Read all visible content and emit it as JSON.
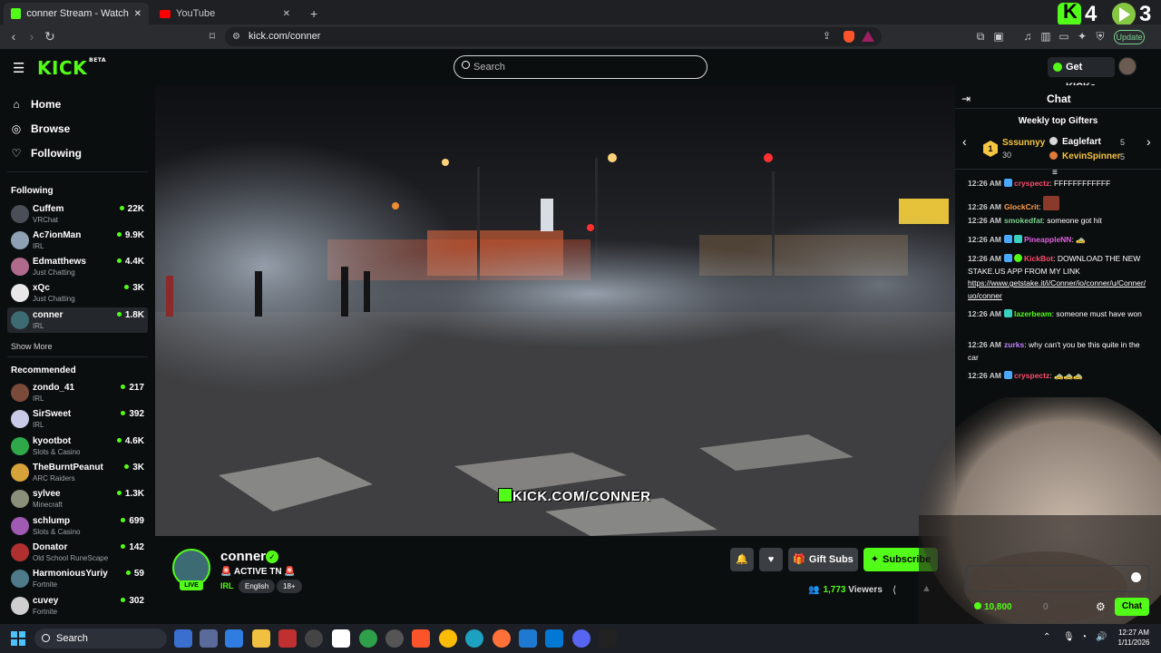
{
  "browser": {
    "tabs": [
      {
        "title": "conner Stream - Watch Live o",
        "active": true
      },
      {
        "title": "YouTube",
        "active": false
      }
    ],
    "url": "kick.com/conner",
    "update_label": "Update"
  },
  "overlay": {
    "counter_a": "4",
    "counter_b": "3"
  },
  "header": {
    "logo": "KICK",
    "logo_beta": "BETA",
    "search_placeholder": "Search",
    "get_kicks_label": "Get KICKs"
  },
  "sidebar": {
    "nav": [
      {
        "label": "Home",
        "icon": "home-icon"
      },
      {
        "label": "Browse",
        "icon": "compass-icon"
      },
      {
        "label": "Following",
        "icon": "heart-icon"
      }
    ],
    "following_header": "Following",
    "following": [
      {
        "name": "Cuffem",
        "category": "VRChat",
        "viewers": "22K",
        "avatar_color": "#4a4f57"
      },
      {
        "name": "Ac7ionMan",
        "category": "IRL",
        "viewers": "9.9K",
        "avatar_color": "#8ea0b4"
      },
      {
        "name": "Edmatthews",
        "category": "Just Chatting",
        "viewers": "4.4K",
        "avatar_color": "#b06a8c"
      },
      {
        "name": "xQc",
        "category": "Just Chatting",
        "viewers": "3K",
        "avatar_color": "#e8e8e8"
      },
      {
        "name": "conner",
        "category": "IRL",
        "viewers": "1.8K",
        "avatar_color": "#3d6b73"
      }
    ],
    "show_more": "Show More",
    "recommended_header": "Recommended",
    "recommended": [
      {
        "name": "zondo_41",
        "category": "IRL",
        "viewers": "217",
        "avatar_color": "#7a4a3a"
      },
      {
        "name": "SirSweet",
        "category": "IRL",
        "viewers": "392",
        "avatar_color": "#c9cbe6"
      },
      {
        "name": "kyootbot",
        "category": "Slots & Casino",
        "viewers": "4.6K",
        "avatar_color": "#2fa84a"
      },
      {
        "name": "TheBurntPeanut",
        "category": "ARC Raiders",
        "viewers": "3K",
        "avatar_color": "#d6a23a"
      },
      {
        "name": "sylvee",
        "category": "Minecraft",
        "viewers": "1.3K",
        "avatar_color": "#8a8f7a"
      },
      {
        "name": "schlump",
        "category": "Slots & Casino",
        "viewers": "699",
        "avatar_color": "#a05ab4"
      },
      {
        "name": "Donator",
        "category": "Old School RuneScape",
        "viewers": "142",
        "avatar_color": "#b03030"
      },
      {
        "name": "HarmoniousYuriy",
        "category": "Fortnite",
        "viewers": "59",
        "avatar_color": "#4e7a8a"
      },
      {
        "name": "cuvey",
        "category": "Fortnite",
        "viewers": "302",
        "avatar_color": "#cfcfcf"
      }
    ]
  },
  "video": {
    "watermark": "KICK.COM/CONNER"
  },
  "stream": {
    "streamer": "conner",
    "live_label": "LIVE",
    "title": "🚨 ACTIVE TN 🚨",
    "category": "IRL",
    "tags": [
      "English",
      "18+"
    ],
    "gift_subs_label": "Gift Subs",
    "subscribe_label": "Subscribe",
    "viewer_count": "1,773",
    "viewers_label": "Viewers"
  },
  "chat": {
    "header": "Chat",
    "gifters_title": "Weekly top Gifters",
    "gifters": [
      {
        "rank": "1",
        "name": "Sssunnyy",
        "count": "30",
        "color": "#f5c542"
      },
      {
        "name": "Eaglefart",
        "count": "5",
        "color": "#ffffff"
      },
      {
        "name": "KevinSpinner",
        "count": "5",
        "color": "#f5c542"
      }
    ],
    "messages": [
      {
        "time": "12:26 AM",
        "user": "cryspectz",
        "color": "#ff4d6d",
        "text": "FFFFFFFFFFFF"
      },
      {
        "time": "12:26 AM",
        "user": "GlockCrit",
        "color": "#ff9d4d",
        "text": ""
      },
      {
        "time": "12:26 AM",
        "user": "smokedfat",
        "color": "#7ad18f",
        "text": "someone got hit"
      },
      {
        "time": "12:26 AM",
        "user": "PineappleNN",
        "color": "#e060e0",
        "text": "🚕"
      },
      {
        "time": "12:26 AM",
        "user": "KickBot",
        "color": "#ff4d6d",
        "text": "DOWNLOAD THE NEW STAKE.US APP FROM MY LINK",
        "link": "https://www.getstake.it/i/Conner/io/conner/u/Conner/uo/conner"
      },
      {
        "time": "12:26 AM",
        "user": "lazerbeam",
        "color": "#53fc18",
        "text": "someone must have won"
      },
      {
        "time": "12:26 AM",
        "user": "zurks",
        "color": "#c080ff",
        "text": "why can't you be this quite in the car"
      },
      {
        "time": "12:26 AM",
        "user": "cryspectz",
        "color": "#ff4d6d",
        "text": "🚕🚕🚕"
      }
    ],
    "kicks_balance": "10,800",
    "kicks_secondary": "0",
    "send_label": "Chat"
  },
  "taskbar": {
    "search_label": "Search",
    "time": "12:27 AM",
    "date": "1/11/2026"
  }
}
